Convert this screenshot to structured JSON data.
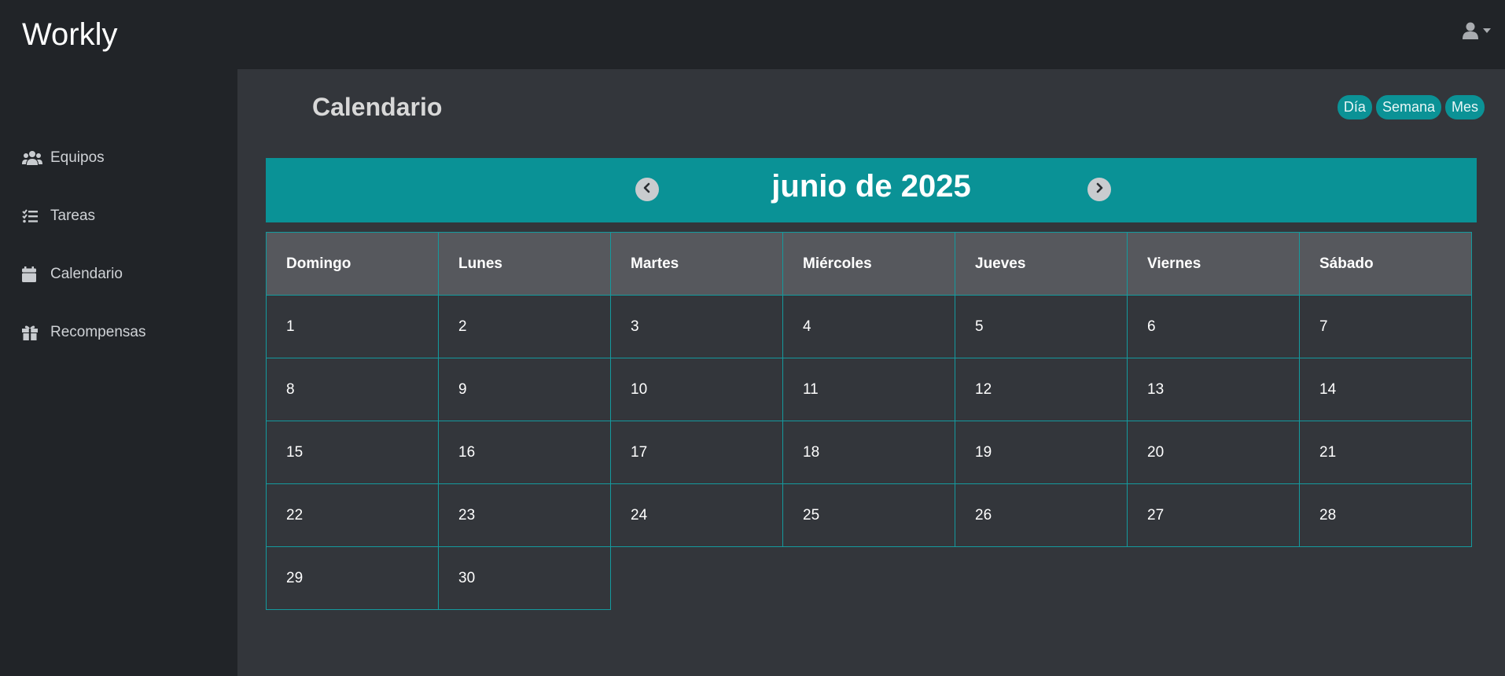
{
  "app": {
    "brand": "Workly"
  },
  "user_menu": {
    "icon": "user-icon",
    "caret": "caret-down-icon"
  },
  "sidebar": {
    "items": [
      {
        "label": "Equipos",
        "icon": "users-icon"
      },
      {
        "label": "Tareas",
        "icon": "tasks-list-icon"
      },
      {
        "label": "Calendario",
        "icon": "calendar-icon"
      },
      {
        "label": "Recompensas",
        "icon": "gift-icon"
      }
    ]
  },
  "page": {
    "title": "Calendario",
    "views": [
      "Día",
      "Semana",
      "Mes"
    ]
  },
  "calendar": {
    "month_title": "junio de 2025",
    "weekdays": [
      "Domingo",
      "Lunes",
      "Martes",
      "Miércoles",
      "Jueves",
      "Viernes",
      "Sábado"
    ],
    "weeks": [
      [
        "1",
        "2",
        "3",
        "4",
        "5",
        "6",
        "7"
      ],
      [
        "8",
        "9",
        "10",
        "11",
        "12",
        "13",
        "14"
      ],
      [
        "15",
        "16",
        "17",
        "18",
        "19",
        "20",
        "21"
      ],
      [
        "22",
        "23",
        "24",
        "25",
        "26",
        "27",
        "28"
      ],
      [
        "29",
        "30"
      ]
    ]
  },
  "colors": {
    "accent": "#0a9296",
    "sidebar_bg": "#212428",
    "main_bg": "#33363b",
    "header_cell_bg": "#56585d"
  }
}
